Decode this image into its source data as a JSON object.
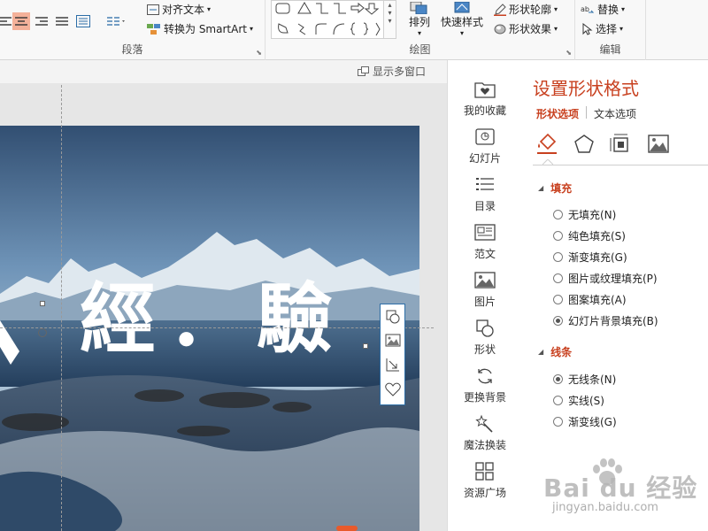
{
  "ribbon": {
    "paragraph_group": "段落",
    "drawing_group": "绘图",
    "editing_group": "编辑",
    "align_text": "对齐文本",
    "convert_smartart": "转换为 SmartArt",
    "arrange": "排列",
    "quick_styles": "快速样式",
    "shape_outline": "形状轮廓",
    "shape_effects": "形状效果",
    "replace": "替换",
    "select": "选择"
  },
  "workspace": {
    "multi_window": "显示多窗口",
    "slide_text": "經．驗"
  },
  "sidebar": {
    "items": [
      {
        "label": "我的收藏",
        "icon": "favorites-icon"
      },
      {
        "label": "幻灯片",
        "icon": "slides-icon"
      },
      {
        "label": "目录",
        "icon": "list-icon"
      },
      {
        "label": "范文",
        "icon": "template-icon"
      },
      {
        "label": "图片",
        "icon": "picture-icon"
      },
      {
        "label": "形状",
        "icon": "shape-icon"
      },
      {
        "label": "更换背景",
        "icon": "refresh-icon"
      },
      {
        "label": "魔法换装",
        "icon": "magic-wand-icon"
      },
      {
        "label": "资源广场",
        "icon": "grid-icon"
      }
    ]
  },
  "pane": {
    "title": "设置形状格式",
    "tab_shape": "形状选项",
    "tab_text": "文本选项",
    "fill": {
      "heading": "填充",
      "options": [
        {
          "label": "无填充(N)",
          "selected": false
        },
        {
          "label": "纯色填充(S)",
          "selected": false
        },
        {
          "label": "渐变填充(G)",
          "selected": false
        },
        {
          "label": "图片或纹理填充(P)",
          "selected": false
        },
        {
          "label": "图案填充(A)",
          "selected": false
        },
        {
          "label": "幻灯片背景填充(B)",
          "selected": true
        }
      ]
    },
    "line": {
      "heading": "线条",
      "options": [
        {
          "label": "无线条(N)",
          "selected": true
        },
        {
          "label": "实线(S)",
          "selected": false
        },
        {
          "label": "渐变线(G)",
          "selected": false
        }
      ]
    }
  },
  "watermark": {
    "logo": "Bai du 经验",
    "url": "jingyan.baidu.com"
  },
  "colors": {
    "accent": "#c8401f",
    "selection_border": "#2d6ea7"
  }
}
